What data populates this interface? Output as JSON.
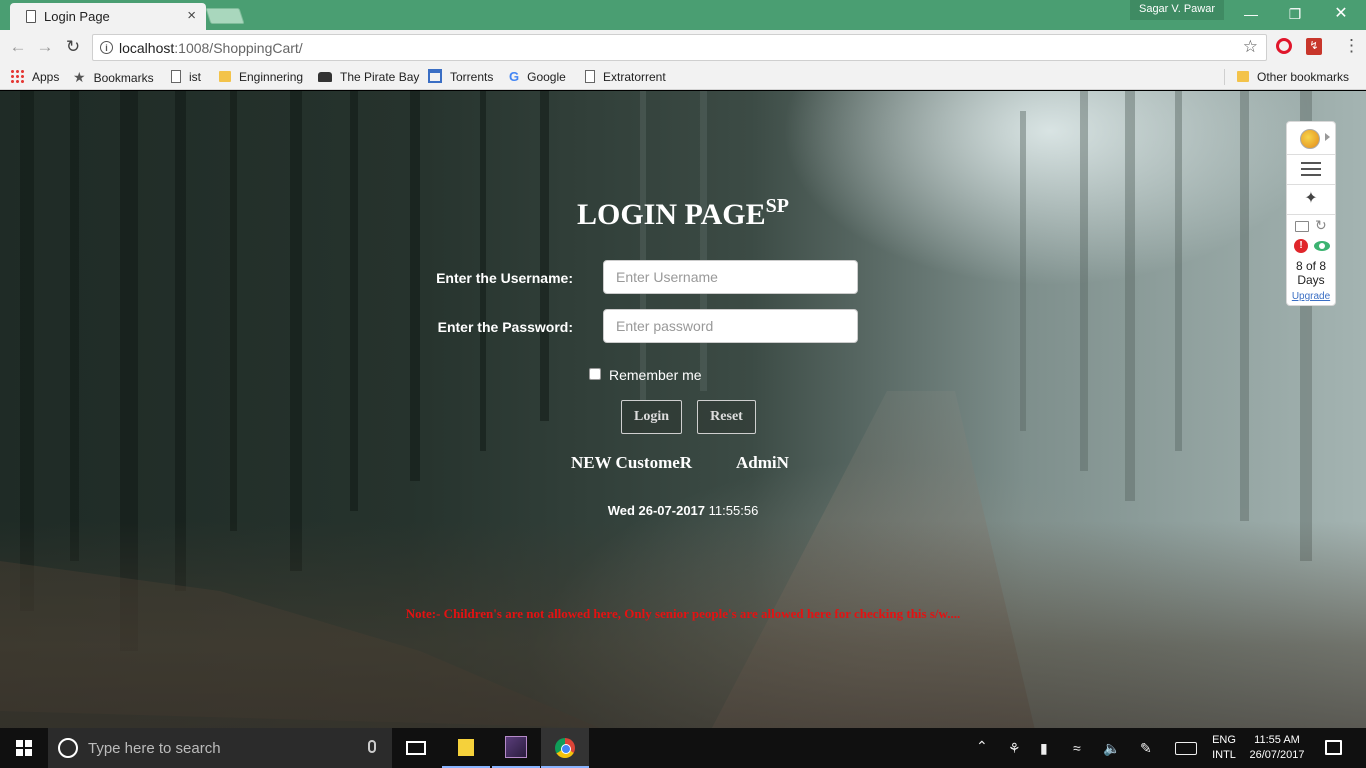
{
  "browser": {
    "tab_title": "Login Page",
    "tab_close": "×",
    "profile_name": "Sagar V. Pawar",
    "window_controls": {
      "minimize": "—",
      "restore": "❐",
      "close": "✕"
    },
    "url_host": "localhost",
    "url_path": ":1008/ShoppingCart/",
    "bookmarks": [
      "Apps",
      "Bookmarks",
      "ist",
      "Enginnering",
      "The Pirate Bay",
      "Torrents",
      "Google",
      "Extratorrent"
    ],
    "other_bookmarks": "Other bookmarks"
  },
  "login": {
    "title": "LOGIN PAGE",
    "title_sup": "SP",
    "username_label": "Enter the Username:",
    "username_placeholder": "Enter Username",
    "username_value": "",
    "password_label": "Enter the Password:",
    "password_placeholder": "Enter password",
    "password_value": "",
    "remember_label": "Remember me",
    "remember_checked": false,
    "login_button": "Login",
    "reset_button": "Reset",
    "new_customer_link": "NEW CustomeR",
    "admin_link": "AdmiN",
    "date": "Wed 26-07-2017",
    "time": "11:55:56",
    "note": "Note:- Children's are not allowed here, Only senior people's are allowed here for checking this s/w...."
  },
  "extension": {
    "days_line1": "8 of 8",
    "days_line2": "Days",
    "upgrade_label": "Upgrade"
  },
  "taskbar": {
    "search_placeholder": "Type here to search",
    "lang_line1": "ENG",
    "lang_line2": "INTL",
    "clock_time": "11:55 AM",
    "clock_date": "26/07/2017"
  },
  "colors": {
    "tab_bar": "#4a9e72",
    "note_text": "#e31212",
    "taskbar": "#101010"
  }
}
